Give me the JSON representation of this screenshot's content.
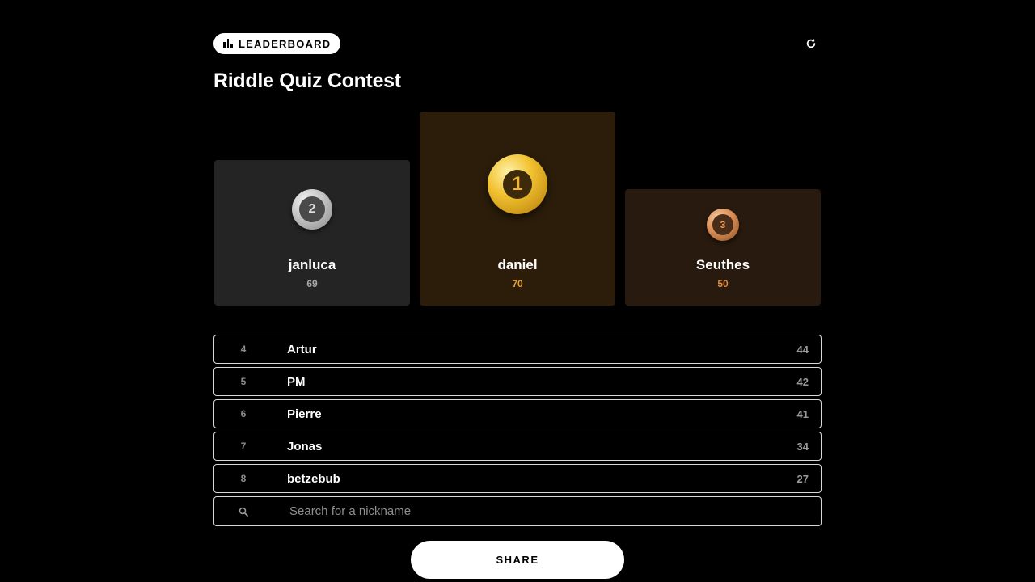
{
  "header": {
    "badge_label": "LEADERBOARD",
    "badge_icon": "bar-chart-icon",
    "refresh_icon": "refresh-icon"
  },
  "page_title": "Riddle Quiz Contest",
  "podium": {
    "first": {
      "rank": "1",
      "name": "daniel",
      "score": "70",
      "medal": "gold-medal-icon",
      "accent": "#e8a02a"
    },
    "second": {
      "rank": "2",
      "name": "janluca",
      "score": "69",
      "medal": "silver-medal-icon",
      "accent": "#a9a9a9"
    },
    "third": {
      "rank": "3",
      "name": "Seuthes",
      "score": "50",
      "medal": "bronze-medal-icon",
      "accent": "#e08a3c"
    }
  },
  "rankings": [
    {
      "rank": "4",
      "name": "Artur",
      "score": "44"
    },
    {
      "rank": "5",
      "name": "PM",
      "score": "42"
    },
    {
      "rank": "6",
      "name": "Pierre",
      "score": "41"
    },
    {
      "rank": "7",
      "name": "Jonas",
      "score": "34"
    },
    {
      "rank": "8",
      "name": "betzebub",
      "score": "27"
    }
  ],
  "search": {
    "placeholder": "Search for a nickname",
    "value": "",
    "icon": "search-icon"
  },
  "share_label": "SHARE",
  "colors": {
    "background": "#000000",
    "gold_card": "#2b1d0a",
    "silver_card": "#242424",
    "bronze_card": "#281a0e"
  }
}
